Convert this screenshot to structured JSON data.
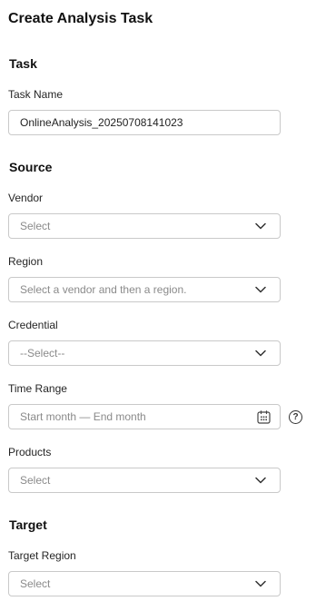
{
  "page": {
    "title": "Create Analysis Task"
  },
  "task": {
    "section_title": "Task",
    "task_name": {
      "label": "Task Name",
      "value": "OnlineAnalysis_20250708141023"
    }
  },
  "source": {
    "section_title": "Source",
    "vendor": {
      "label": "Vendor",
      "placeholder": "Select"
    },
    "region": {
      "label": "Region",
      "placeholder": "Select a vendor and then a region."
    },
    "credential": {
      "label": "Credential",
      "placeholder": "--Select--"
    },
    "time_range": {
      "label": "Time Range",
      "placeholder": "Start month — End month",
      "help_glyph": "?"
    },
    "products": {
      "label": "Products",
      "placeholder": "Select"
    }
  },
  "target": {
    "section_title": "Target",
    "target_region": {
      "label": "Target Region",
      "placeholder": "Select"
    }
  },
  "icons": {
    "dropdown": "chevron-down-icon",
    "date": "calendar-icon",
    "help": "question-circle-icon"
  },
  "colors": {
    "border": "#c9c9c9",
    "placeholder": "#8a8a8a",
    "text": "#1f1f1f"
  }
}
